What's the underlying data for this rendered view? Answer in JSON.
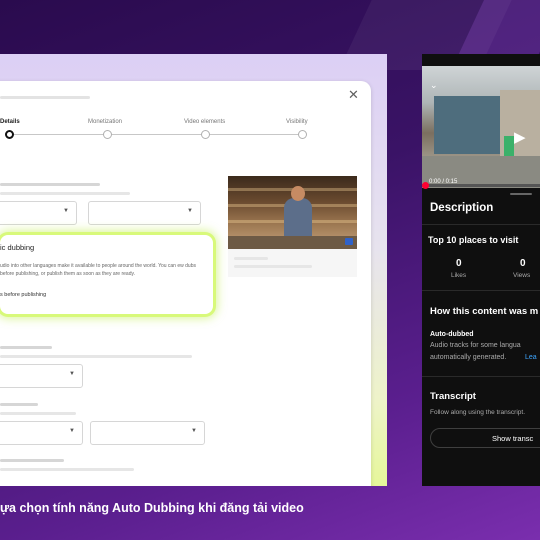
{
  "dialog": {
    "close_icon": "✕",
    "steps": [
      {
        "label": "Details",
        "active": true
      },
      {
        "label": "Monetization",
        "active": false
      },
      {
        "label": "Video elements",
        "active": false
      },
      {
        "label": "Visibility",
        "active": false
      }
    ],
    "dubbing": {
      "title": "ic dubbing",
      "description": "udio into other languages make it available to people around the world. You can ew dubs before publishing, or publish them as soon as they are ready.",
      "link": "s before publishing"
    }
  },
  "caption": "ựa chọn tính năng Auto Dubbing khi đăng tải video",
  "phone": {
    "video_time": "0:00 / 0:15",
    "progress": 0,
    "description_heading": "Description",
    "video_title": "Top 10 places to visit",
    "likes_count": "0",
    "likes_label": "Likes",
    "views_count": "0",
    "views_label": "Views",
    "content_heading": "How this content was m",
    "auto_dubbed_label": "Auto-dubbed",
    "auto_dubbed_line1": "Audio tracks for some langua",
    "auto_dubbed_line2": "automatically generated.",
    "learn_more": "Lea",
    "transcript_heading": "Transcript",
    "transcript_sub": "Follow along using the transcript.",
    "show_transcript": "Show transc"
  },
  "colors": {
    "highlight": "#d8f97a",
    "progress": "#ff0033",
    "link": "#3ea6ff"
  }
}
